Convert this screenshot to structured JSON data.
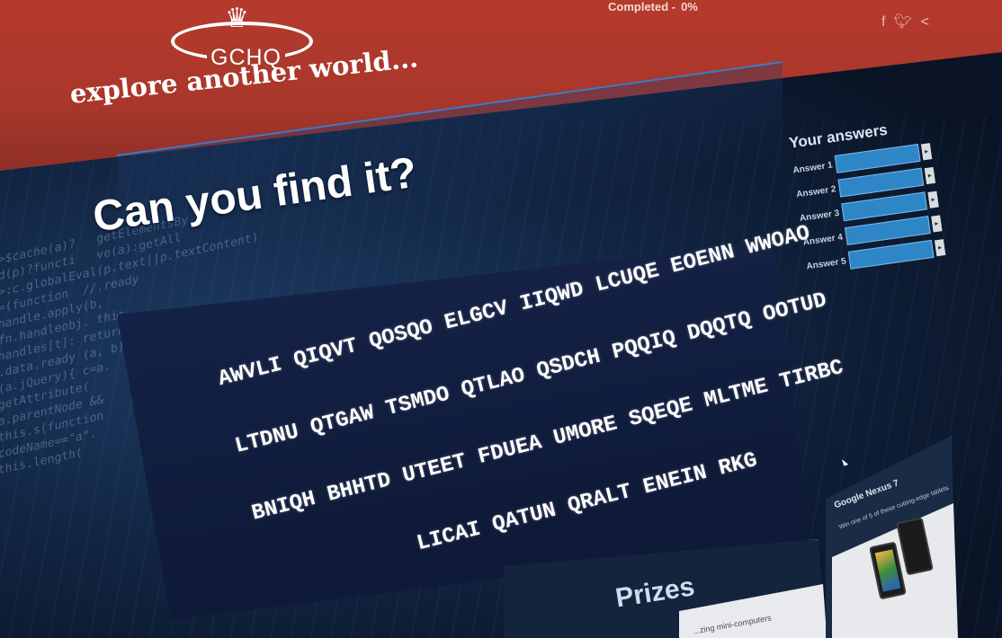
{
  "header": {
    "logo_text": "GCHQ",
    "tagline": "explore another world...",
    "progress_label": "Completed -",
    "progress_value": "0%",
    "social": [
      "f",
      "twitter",
      "share"
    ]
  },
  "main": {
    "headline": "Can you find it?",
    "cipher_lines": [
      "AWVLI QIQVT QOSQO ELGCV IIQWD LCUQE EOENN WWOAO",
      "LTDNU QTGAW TSMDO QTLAO QSDCH PQQIQ DQQTQ OOTUD",
      "BNIQH BHHTD UTEET FDUEA UMORE SQEQE MLTME TIRBC",
      "LICAI QATUN QRALT ENEIN RKG"
    ]
  },
  "answers": {
    "title": "Your answers",
    "items": [
      {
        "label": "Answer 1"
      },
      {
        "label": "Answer 2"
      },
      {
        "label": "Answer 3"
      },
      {
        "label": "Answer 4"
      },
      {
        "label": "Answer 5"
      }
    ]
  },
  "prizes": {
    "title": "Prizes",
    "item1_text": "...zing mini-computers",
    "item2_title": "Google Nexus 7",
    "item2_sub": "Win one of 5 of these cutting-edge tablets"
  },
  "colors": {
    "header_red": "#b53a2c",
    "panel_navy": "#16244a",
    "answer_blue": "#2f86c7"
  }
}
